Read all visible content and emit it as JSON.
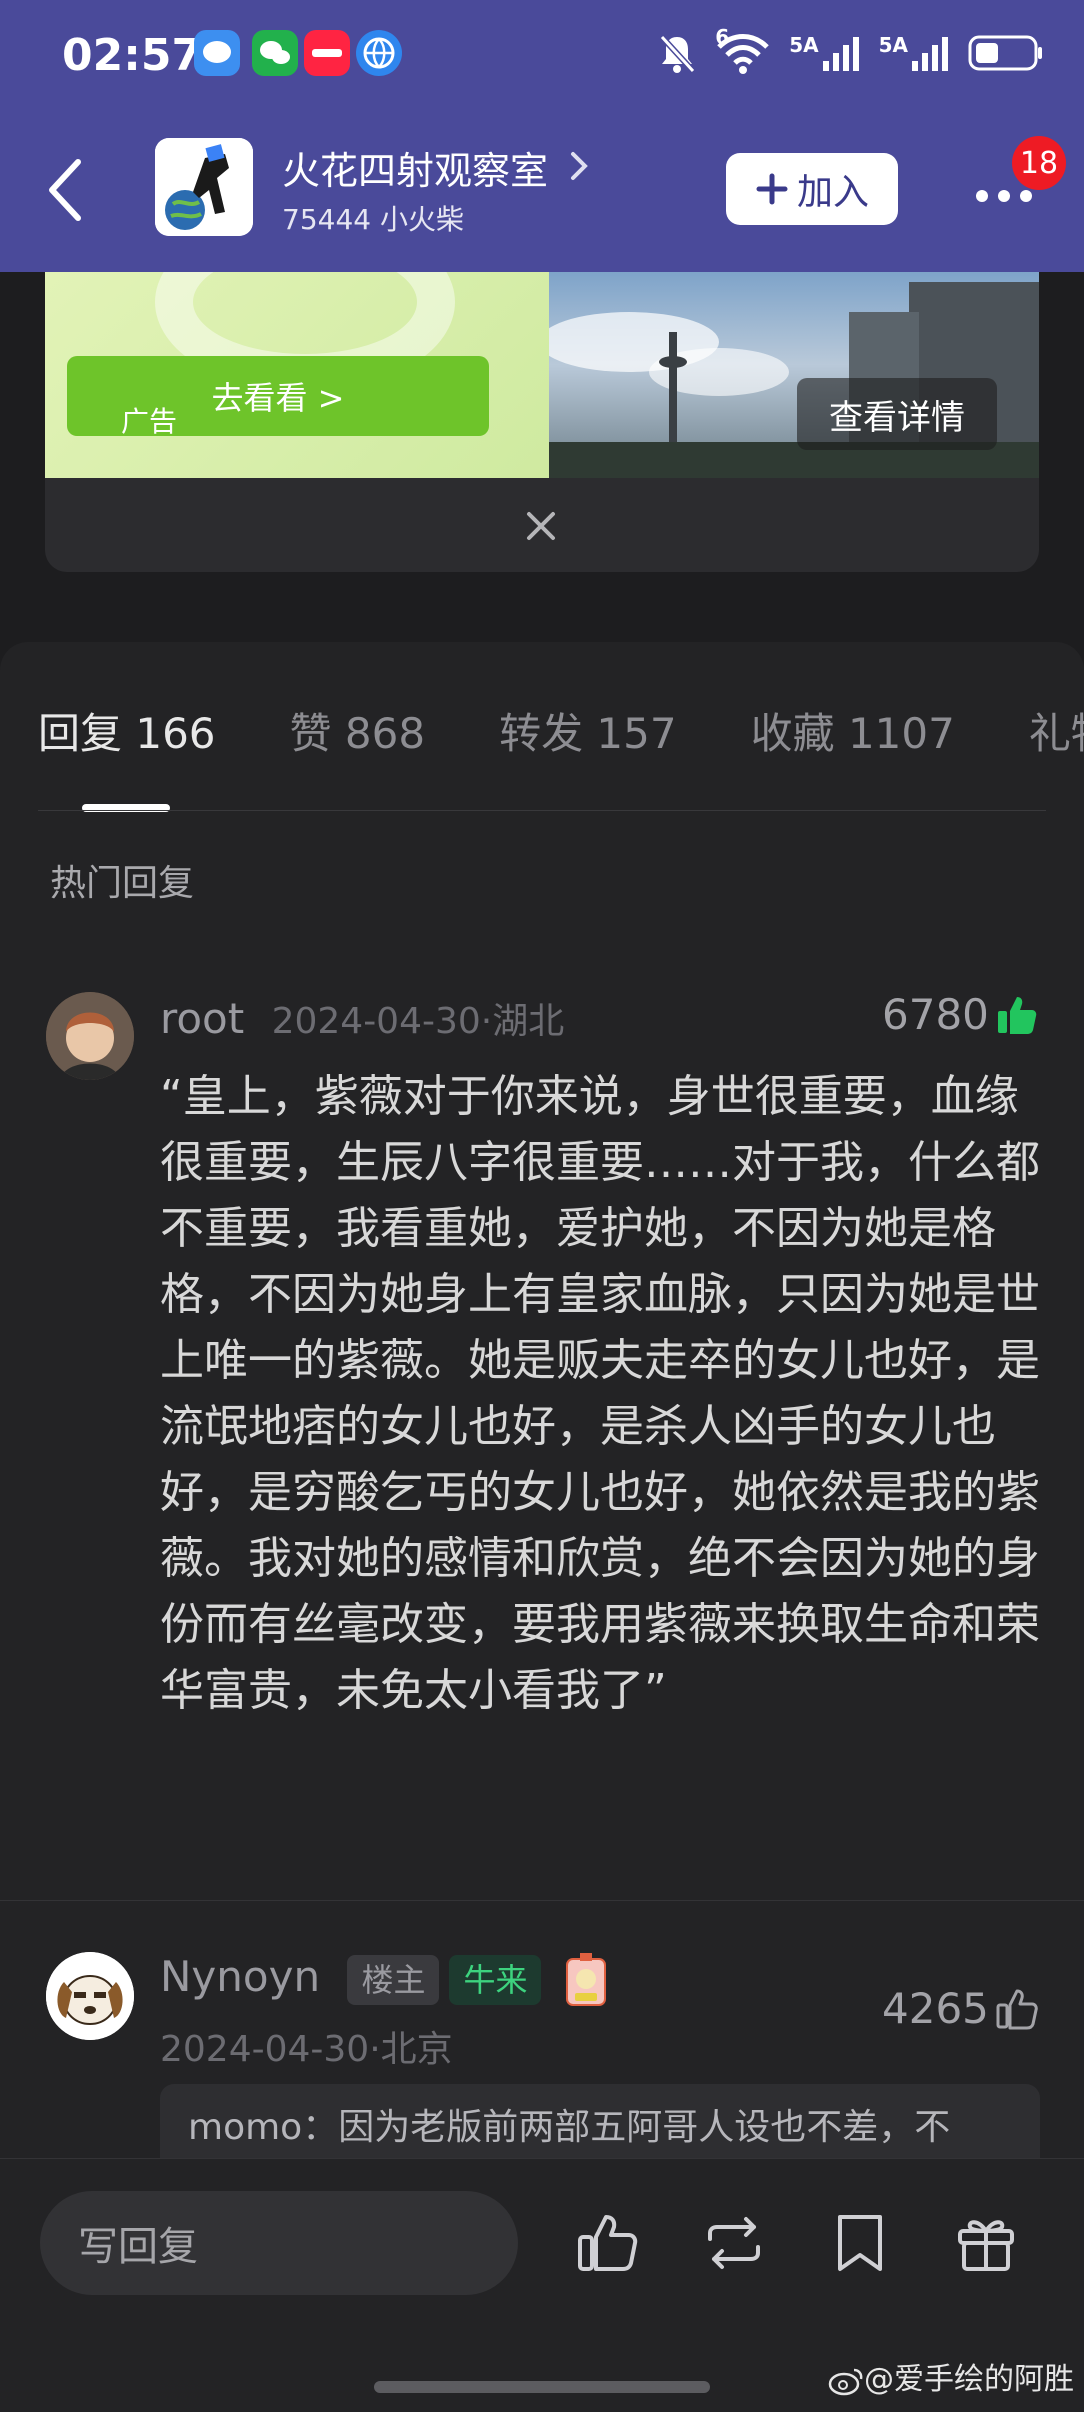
{
  "status": {
    "time": "02:57",
    "net1": "5A",
    "net2": "5A",
    "wifi_label": "6"
  },
  "header": {
    "group_name": "火花四射观察室",
    "group_sub": "75444 小火柴",
    "join_label": "加入",
    "badge_count": "18"
  },
  "ad": {
    "cta": "去看看 >",
    "label": "广告",
    "detail": "查看详情"
  },
  "tabs": [
    {
      "label": "回复 166"
    },
    {
      "label": "赞 868"
    },
    {
      "label": "转发 157"
    },
    {
      "label": "收藏 1107"
    },
    {
      "label": "礼物"
    }
  ],
  "hot_title": "热门回复",
  "comment1": {
    "name": "root",
    "meta": "2024-04-30·湖北",
    "likes": "6780",
    "body": "“皇上，紫薇对于你来说，身世很重要，血缘很重要，生辰八字很重要……对于我，什么都不重要，我看重她，爱护她，不因为她是格格，不因为她身上有皇家血脉，只因为她是世上唯一的紫薇。她是贩夫走卒的女儿也好，是流氓地痞的女儿也好，是杀人凶手的女儿也好，是穷酸乞丐的女儿也好，她依然是我的紫薇。我对她的感情和欣赏，绝不会因为她的身份而有丝毫改变，要我用紫薇来换取生命和荣华富贵，未免太小看我了”"
  },
  "comment2": {
    "name": "Nynoyn",
    "tag_owner": "楼主",
    "tag_cow": "牛来",
    "meta": "2024-04-30·北京",
    "likes": "4265",
    "quote": "momo：因为老版前两部五阿哥人设也不差，不"
  },
  "bottom": {
    "reply_placeholder": "写回复"
  },
  "watermark": "@爱手绘的阿胜",
  "colors": {
    "header_bg": "#4a4a9a",
    "like_active": "#22c55e",
    "badge": "#ee1b24"
  }
}
